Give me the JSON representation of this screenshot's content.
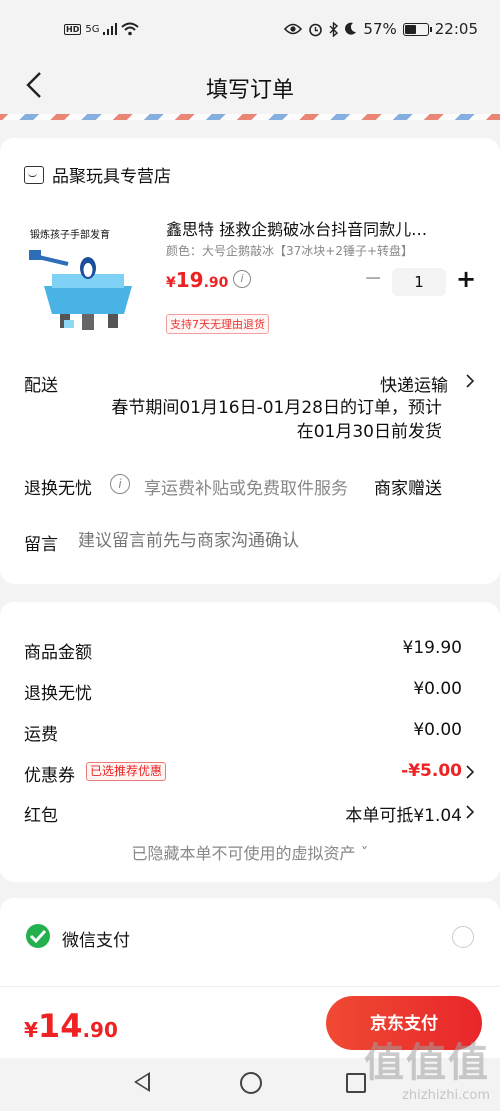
{
  "status_bar": {
    "hd": "HD",
    "network": "5G",
    "battery_percent": 57,
    "battery_text": "57%",
    "time": "22:05"
  },
  "nav": {
    "back_icon": "chevron-left-icon",
    "title": "填写订单"
  },
  "shop": {
    "icon": "store-icon",
    "name": "品聚玩具专营店"
  },
  "product": {
    "title": "鑫思特 拯救企鹅破冰台抖音同款儿…",
    "spec": "颜色：大号企鹅敲冰【37冰块+2锤子+转盘】",
    "price_currency": "¥",
    "price_int": "19",
    "price_dec": ".90",
    "quantity": "1",
    "minus": "−",
    "plus": "+",
    "return_tag": "支持7天无理由退货",
    "image_caption": "锻炼孩子手部发育"
  },
  "shipping": {
    "label": "配送",
    "method": "快递运输",
    "note": "春节期间01月16日-01月28日的订单，预计在01月30日前发货"
  },
  "returns": {
    "label": "退换无忧",
    "desc": "享运费补贴或免费取件服务",
    "gift": "商家赠送"
  },
  "message": {
    "label": "留言",
    "placeholder": "建议留言前先与商家沟通确认"
  },
  "summary": {
    "goods_label": "商品金额",
    "goods_value": "¥19.90",
    "returns_label": "退换无忧",
    "returns_value": "¥0.00",
    "freight_label": "运费",
    "freight_value": "¥0.00",
    "coupon_label": "优惠券",
    "coupon_badge": "已选推荐优惠",
    "coupon_value": "-¥5.00",
    "redpacket_label": "红包",
    "redpacket_value": "本单可抵¥1.04",
    "hidden_assets": "已隐藏本单不可使用的虚拟资产 ˇ"
  },
  "payment": {
    "icon": "wechat-pay-icon",
    "label": "微信支付"
  },
  "bottom": {
    "total_currency": "¥",
    "total_int": "14",
    "total_dec": ".90",
    "pay_button": "京东支付"
  },
  "watermark": {
    "logo": "值值值",
    "url": "zhizhizhi.com"
  },
  "colors": {
    "accent": "#e8262a",
    "background": "#f3f3f3"
  }
}
